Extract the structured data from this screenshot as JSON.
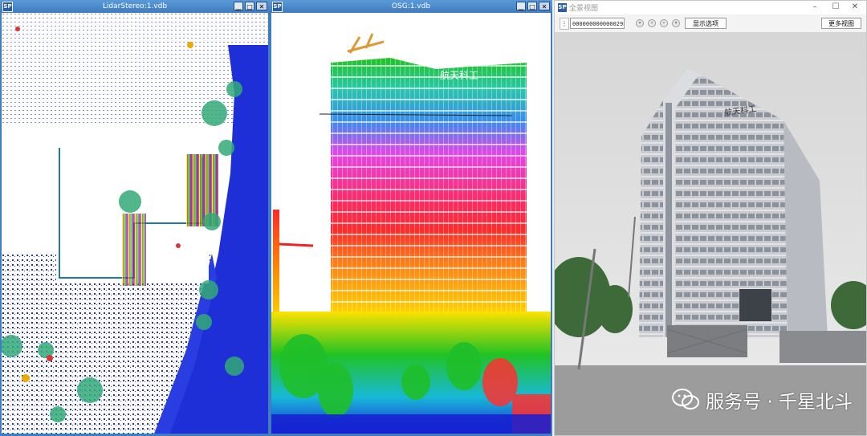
{
  "windows": {
    "left": {
      "title": "LidarStereo:1.vdb",
      "icon": "SP"
    },
    "middle": {
      "title": "OSG:1.vdb",
      "icon": "SP"
    },
    "right": {
      "title": "全景视图",
      "icon": "SP",
      "toolbar": {
        "frame_value": "00000000000002987",
        "show_options_label": "显示选项",
        "more_views_label": "更多视图"
      },
      "building_sign": "航天科工"
    }
  },
  "point_cloud_sign": "航天科工",
  "watermark": {
    "text": "服务号 · 千星北斗"
  },
  "colors": {
    "titlebar": "#3f7cc0",
    "ground_blue": "#1e2fd8"
  }
}
